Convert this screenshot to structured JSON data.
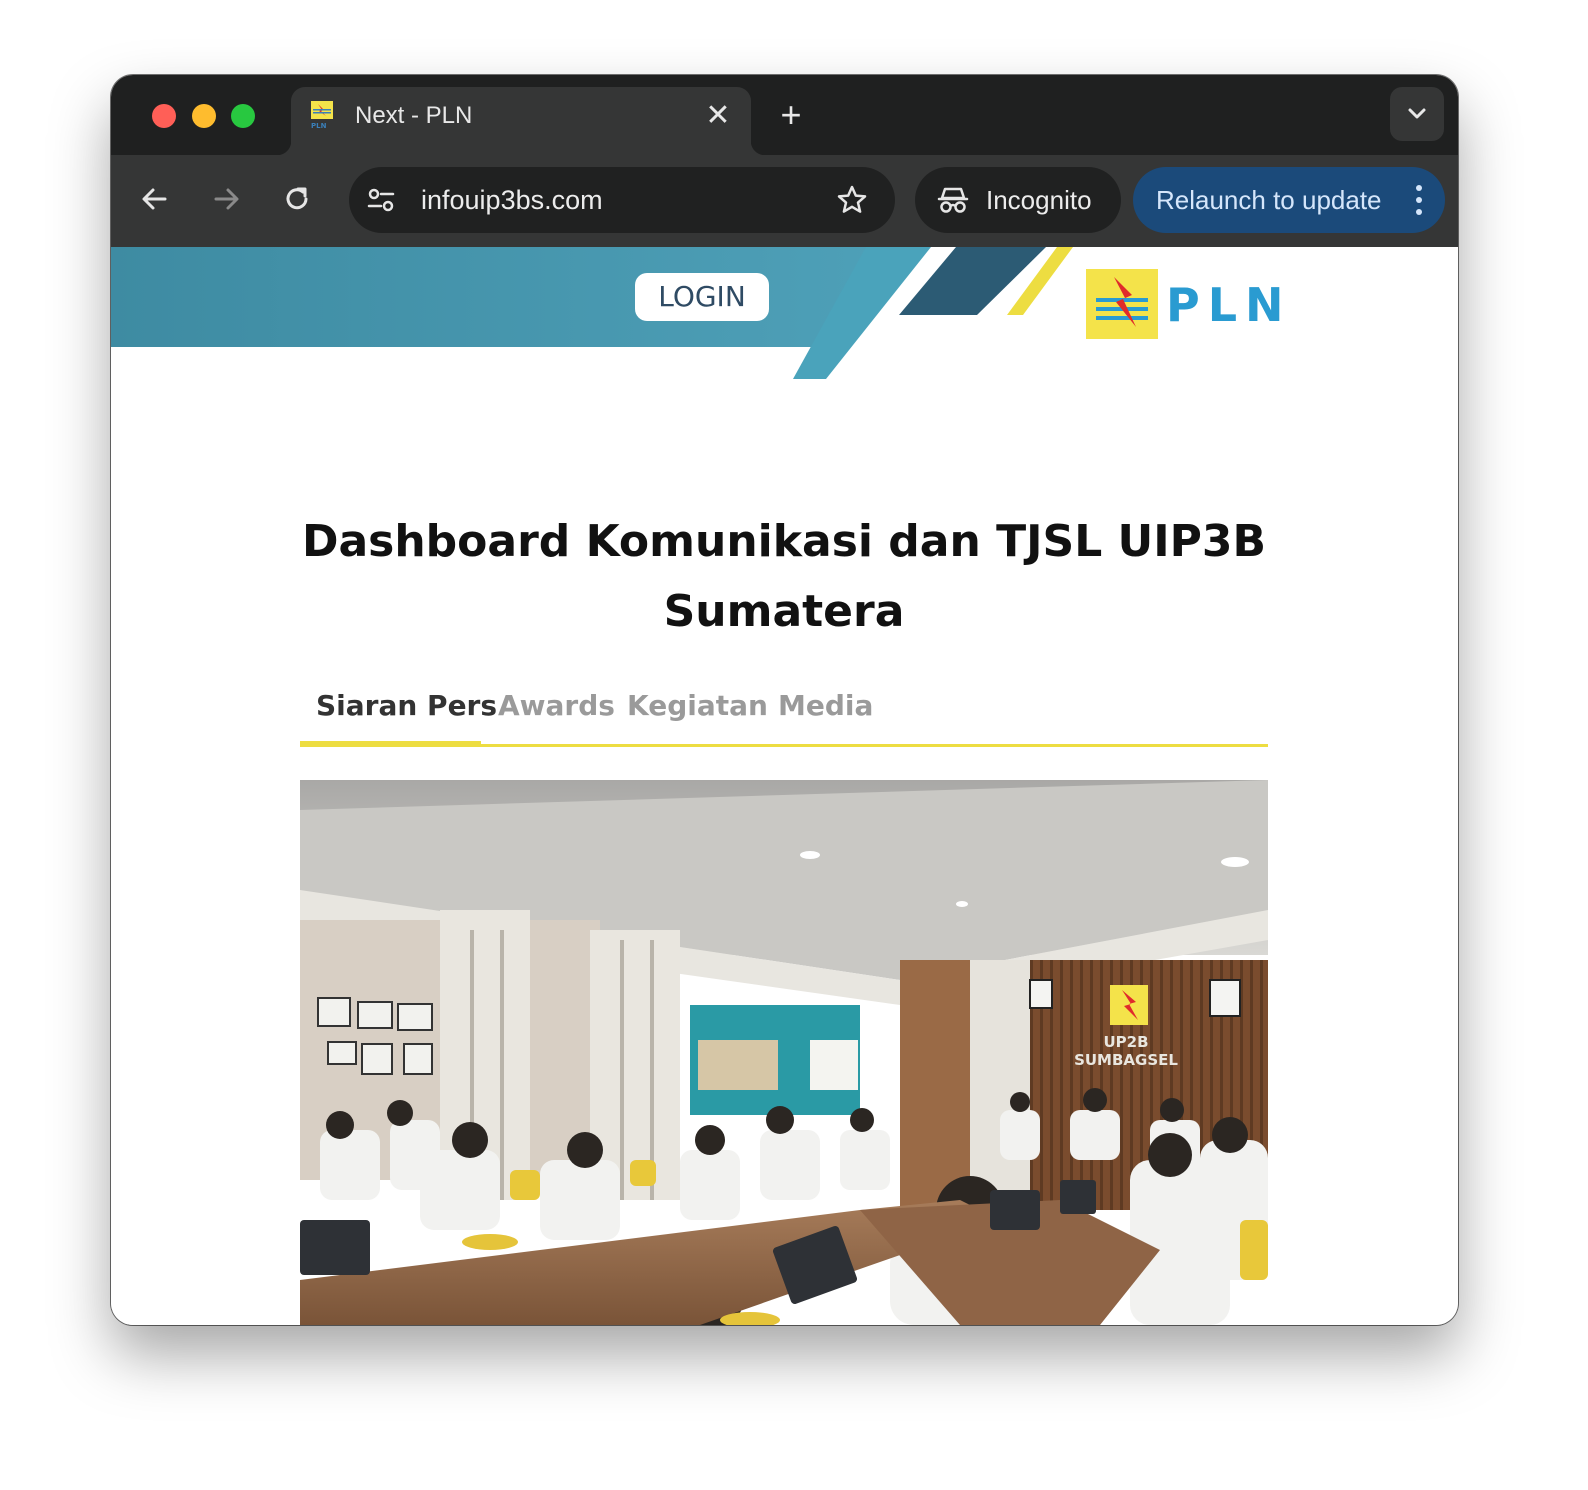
{
  "browser": {
    "tab_title": "Next - PLN",
    "tab_close_glyph": "✕",
    "new_tab_glyph": "+",
    "url": "infouip3bs.com",
    "incognito_label": "Incognito",
    "relaunch_label": "Relaunch to update",
    "colors": {
      "frame": "#1f2020",
      "toolbar": "#353636",
      "relaunch": "#1b4a7a"
    }
  },
  "header": {
    "login_label": "LOGIN",
    "brand": "PLN",
    "colors": {
      "banner": "#4592a8",
      "accent": "#eddd41",
      "dark": "#2c5b74"
    }
  },
  "main": {
    "title_line1": "Dashboard Komunikasi dan TJSL UIP3B",
    "title_line2": "Sumatera",
    "tabs": [
      {
        "label": "Siaran Pers",
        "active": true
      },
      {
        "label": "Awards",
        "active": false
      },
      {
        "label": "Kegiatan",
        "active": false
      },
      {
        "label": "Media",
        "active": false
      }
    ],
    "photo": {
      "wall_sign_line1": "UP2B",
      "wall_sign_line2": "SUMBAGSEL"
    }
  }
}
